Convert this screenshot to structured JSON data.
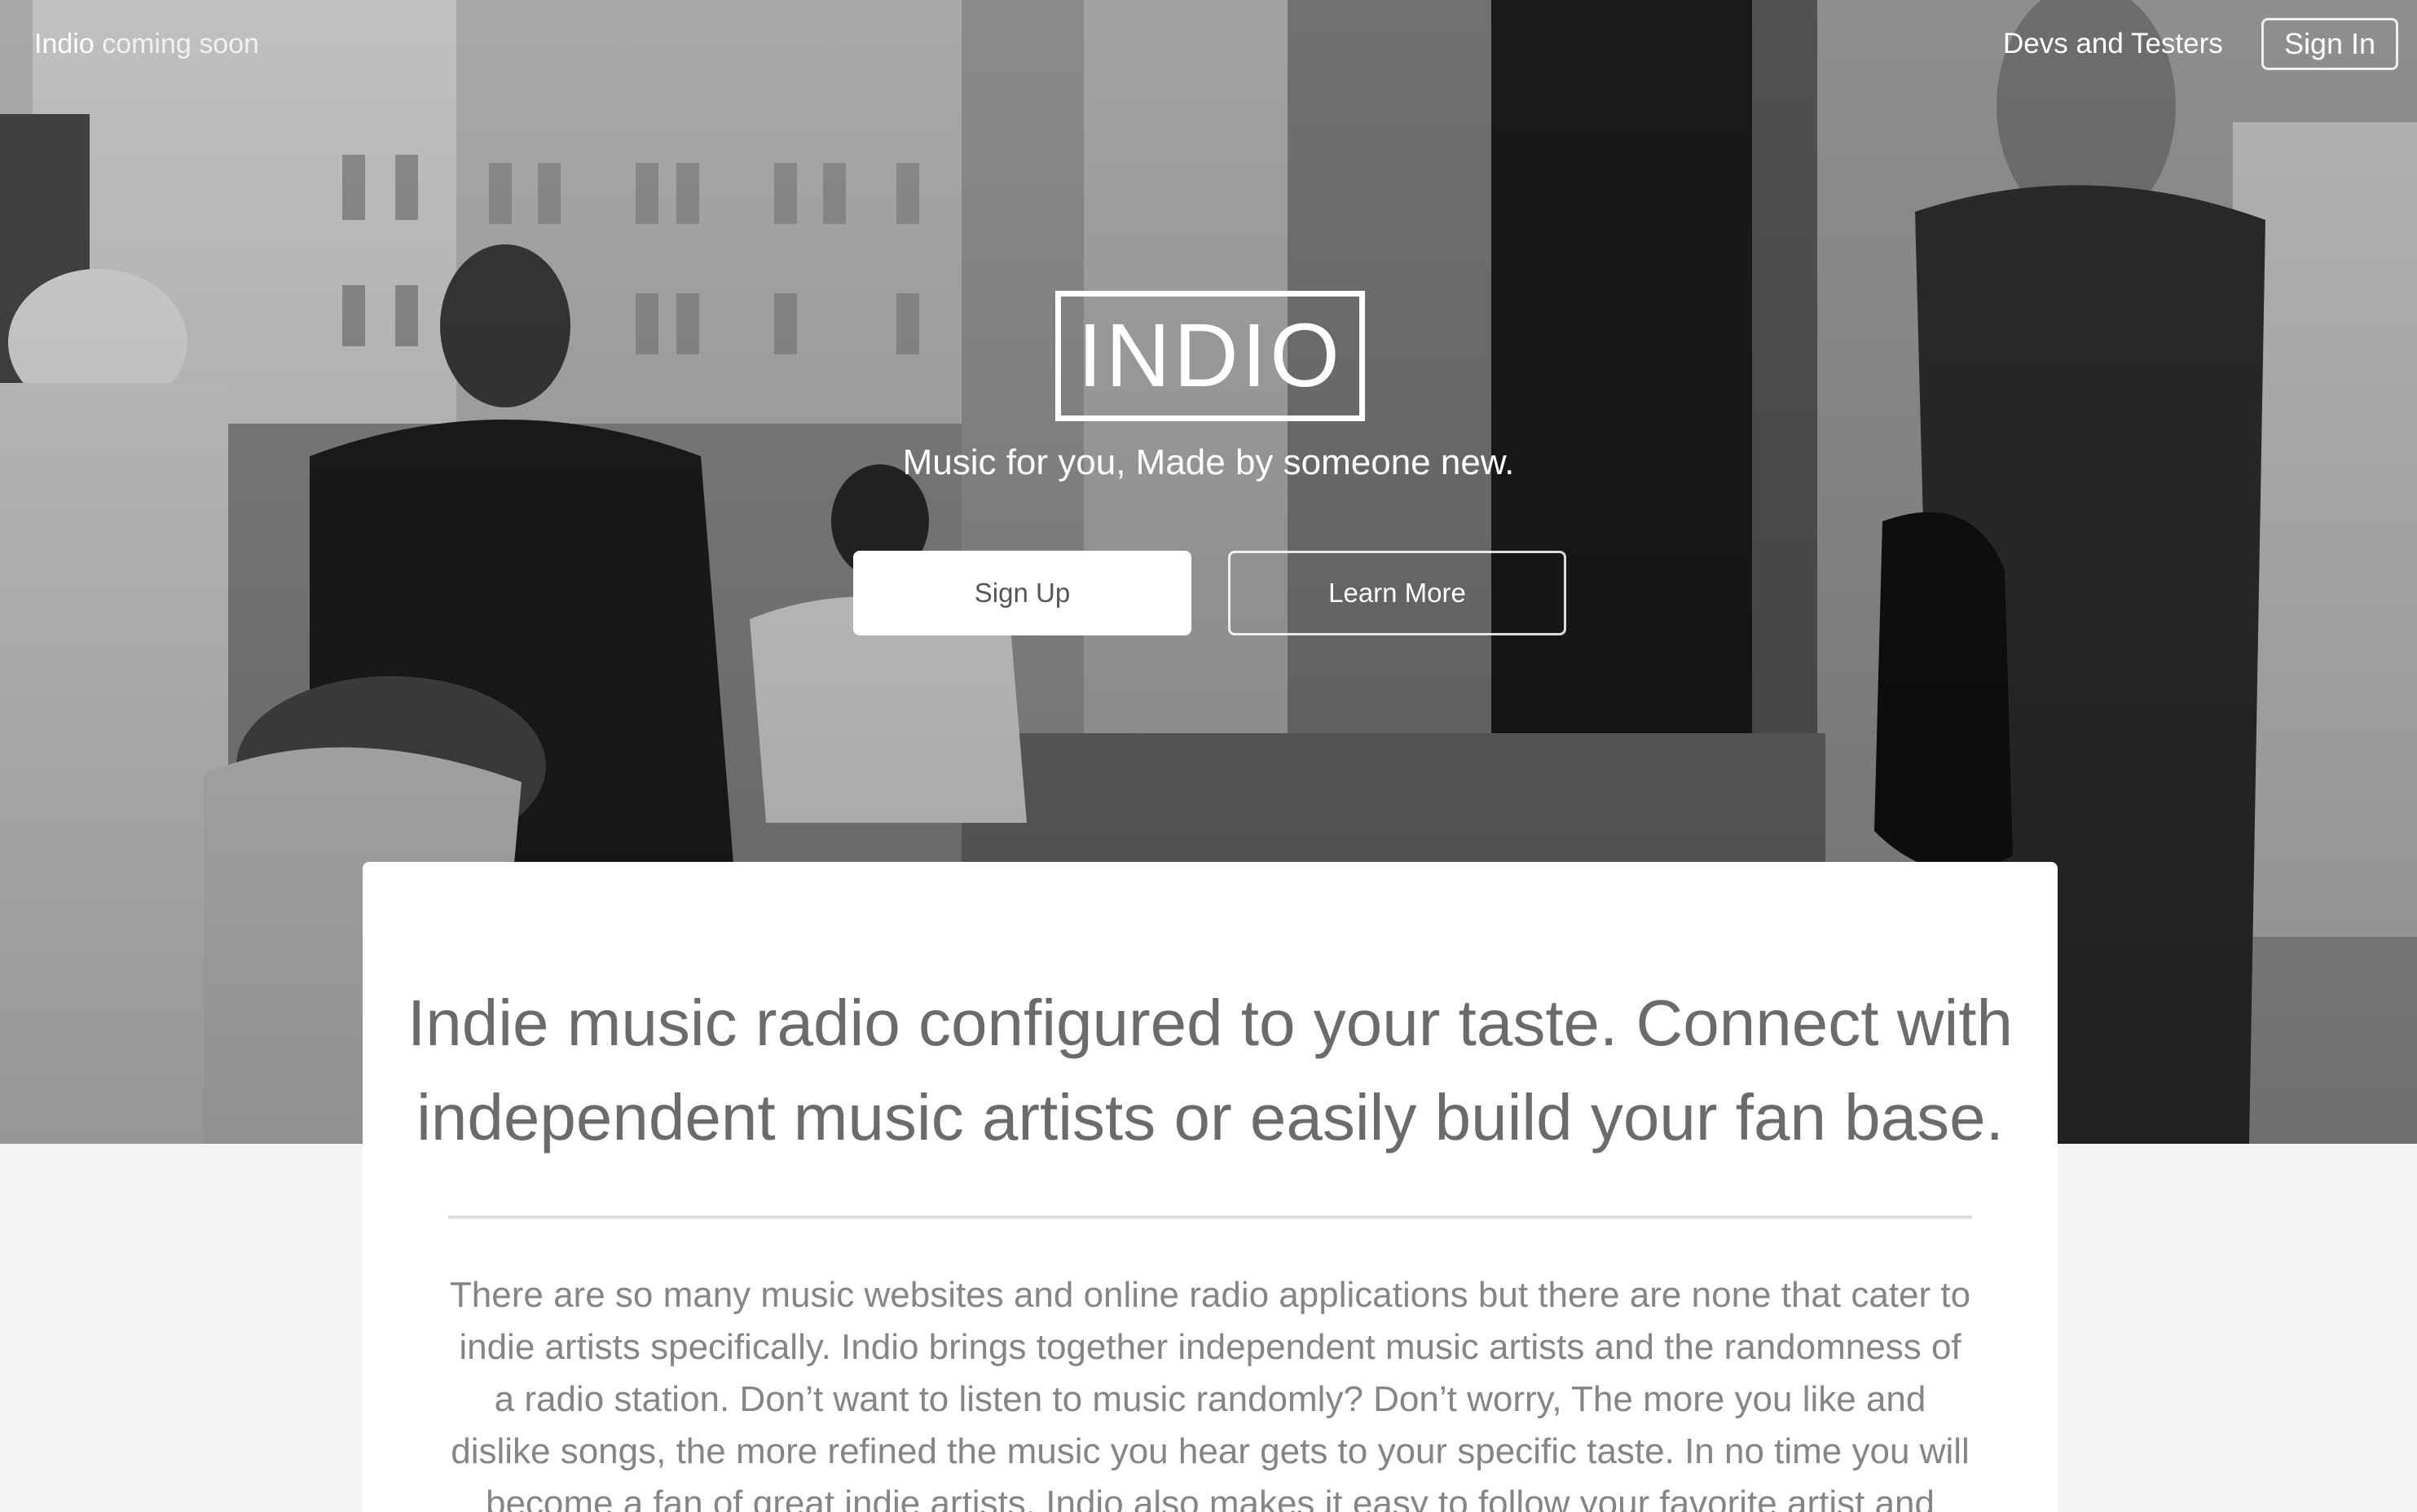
{
  "nav": {
    "brand": "Indio",
    "brand_suffix": "coming soon",
    "devs_link": "Devs and Testers",
    "signin_label": "Sign In"
  },
  "hero": {
    "logo_text": "INDIO",
    "tagline": "Music for you, Made by someone new.",
    "signup_label": "Sign Up",
    "learn_more_label": "Learn More"
  },
  "content": {
    "headline": "Indie music radio configured to your taste. Connect with independent music artists or easily build your fan base.",
    "body": "There are so many music websites and online radio applications but there are none that cater to indie artists specifically. Indio brings together independent music artists and the randomness of a radio station. Don’t want to listen to music randomly? Don’t worry, The more you like and dislike songs, the more refined the music you hear gets to your specific taste. In no time you will become a fan of great indie artists. Indio also makes it easy to follow your favorite artist and gives you"
  },
  "colors": {
    "page_background": "#f4f4f4",
    "card_background": "#ffffff",
    "headline_text": "#6b6b6b",
    "body_text": "#858585"
  }
}
